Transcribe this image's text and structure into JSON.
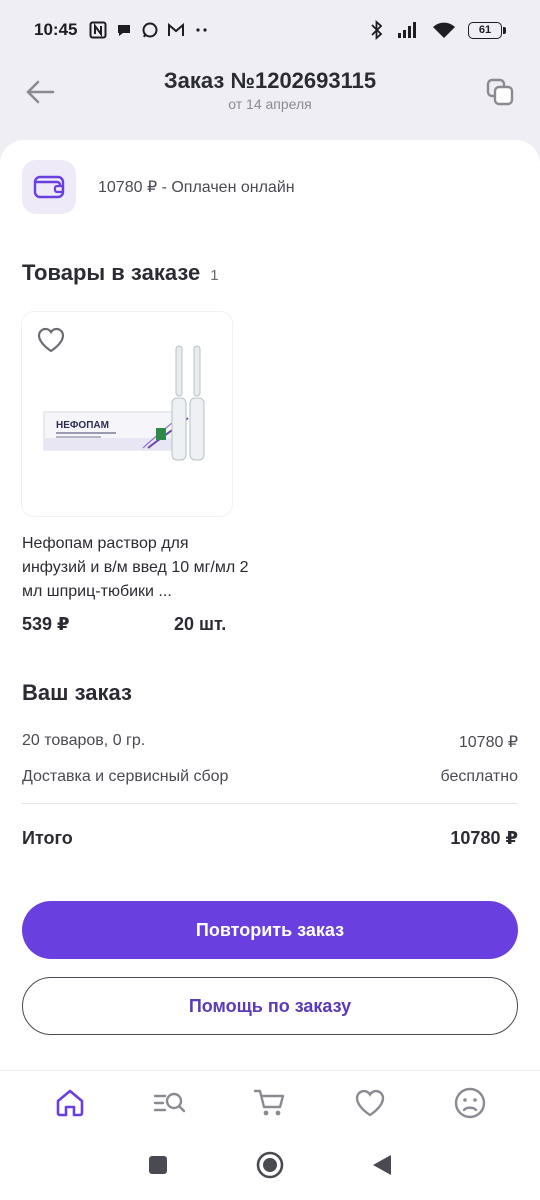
{
  "status_bar": {
    "time": "10:45",
    "battery": "61"
  },
  "header": {
    "title": "Заказ №1202693115",
    "subtitle": "от 14 апреля"
  },
  "payment": {
    "text": "10780 ₽ -  Оплачен онлайн"
  },
  "items_section": {
    "title": "Товары в заказе",
    "count": "1"
  },
  "product": {
    "name": "Нефопам раствор для инфузий и в/м введ 10 мг/мл 2 мл шприц-тюбики ...",
    "price": "539 ₽",
    "qty": "20 шт.",
    "package_label": "НЕФОПАМ"
  },
  "summary": {
    "title": "Ваш заказ",
    "items_label": "20 товаров, 0 гр.",
    "items_value": "10780 ₽",
    "delivery_label": "Доставка и сервисный сбор",
    "delivery_value": "бесплатно",
    "total_label": "Итого",
    "total_value": "10780 ₽"
  },
  "buttons": {
    "repeat": "Повторить заказ",
    "help": "Помощь по заказу"
  },
  "nav": {
    "items": [
      "home-icon",
      "catalog-search-icon",
      "cart-icon",
      "favorites-icon",
      "profile-icon"
    ]
  },
  "colors": {
    "accent": "#6a3fe0",
    "accent_text": "#5b3bb8"
  }
}
